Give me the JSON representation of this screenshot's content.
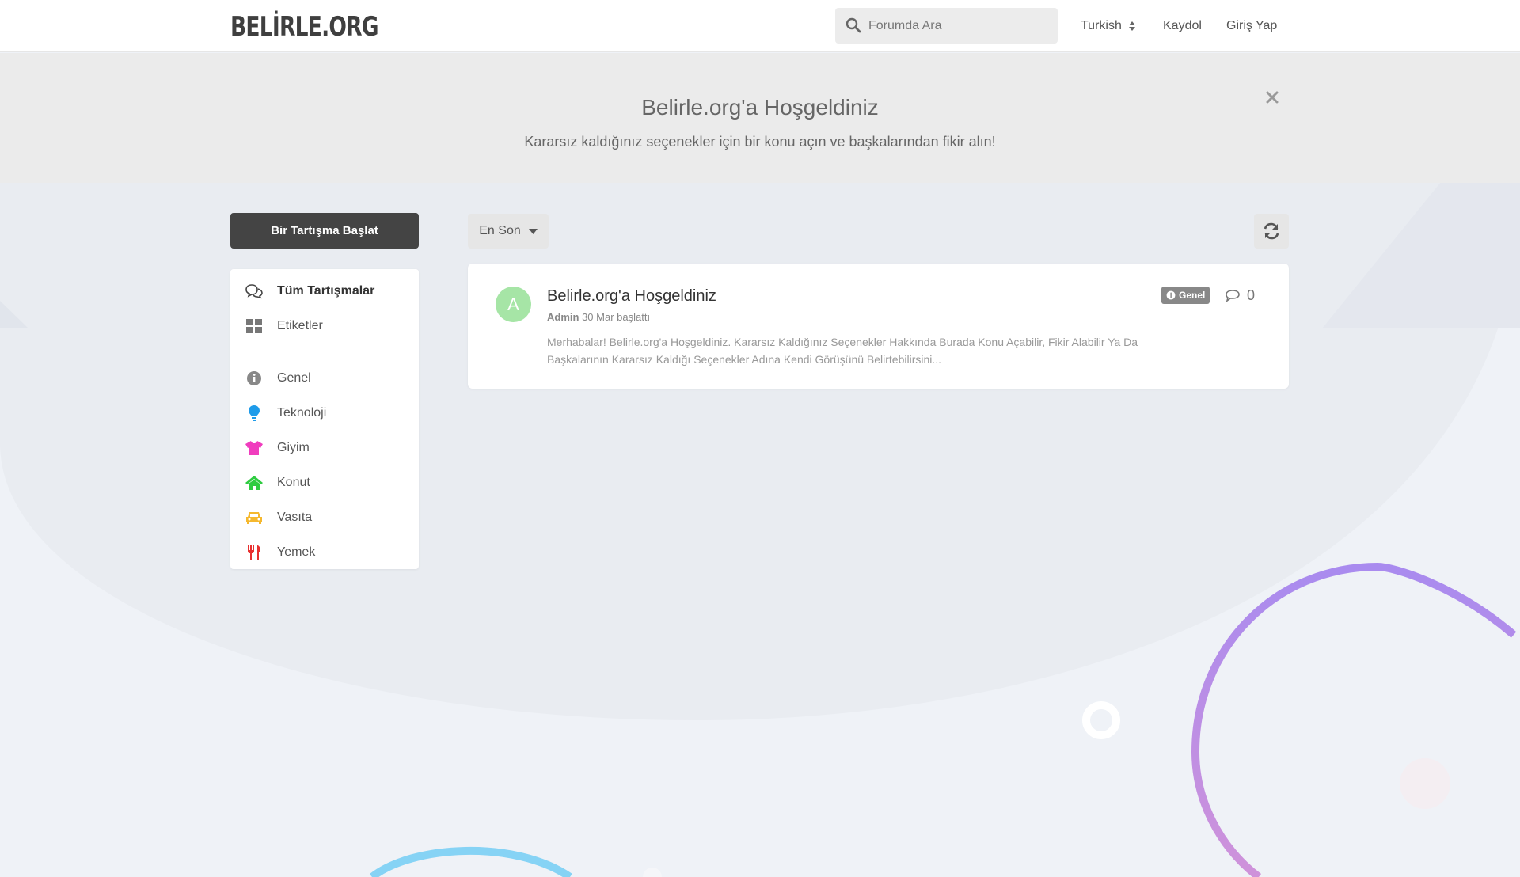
{
  "header": {
    "logo": "BELİRLE.ORG",
    "search_placeholder": "Forumda Ara",
    "language": "Turkish",
    "signup": "Kaydol",
    "login": "Giriş Yap"
  },
  "hero": {
    "title": "Belirle.org'a Hoşgeldiniz",
    "subtitle": "Kararsız kaldığınız seçenekler için bir konu açın ve başkalarından fikir alın!"
  },
  "sidebar": {
    "start_button": "Bir Tartışma Başlat",
    "nav": [
      {
        "label": "Tüm Tartışmalar",
        "icon": "comments-icon"
      },
      {
        "label": "Etiketler",
        "icon": "tags-grid-icon"
      }
    ],
    "tags": [
      {
        "label": "Genel",
        "icon": "info-circle-icon",
        "color": "#888888"
      },
      {
        "label": "Teknoloji",
        "icon": "lightbulb-icon",
        "color": "#1e9be9"
      },
      {
        "label": "Giyim",
        "icon": "tshirt-icon",
        "color": "#f03dbe"
      },
      {
        "label": "Konut",
        "icon": "home-icon",
        "color": "#2ecc40"
      },
      {
        "label": "Vasıta",
        "icon": "car-icon",
        "color": "#f5b82e"
      },
      {
        "label": "Yemek",
        "icon": "utensils-icon",
        "color": "#e8302f"
      }
    ]
  },
  "toolbar": {
    "sort_label": "En Son"
  },
  "discussions": [
    {
      "avatar_letter": "A",
      "avatar_color": "#a6e5a6",
      "title": "Belirle.org'a Hoşgeldiniz",
      "author": "Admin",
      "meta": "30 Mar başlattı",
      "excerpt": "Merhabalar! Belirle.org'a Hoşgeldiniz. Kararsız Kaldığınız Seçenekler Hakkında Burada Konu Açabilir, Fikir Alabilir Ya Da Başkalarının Kararsız Kaldığı Seçenekler Adına Kendi Görüşünü Belirtebilirsini...",
      "tag": "Genel",
      "replies": "0"
    }
  ]
}
